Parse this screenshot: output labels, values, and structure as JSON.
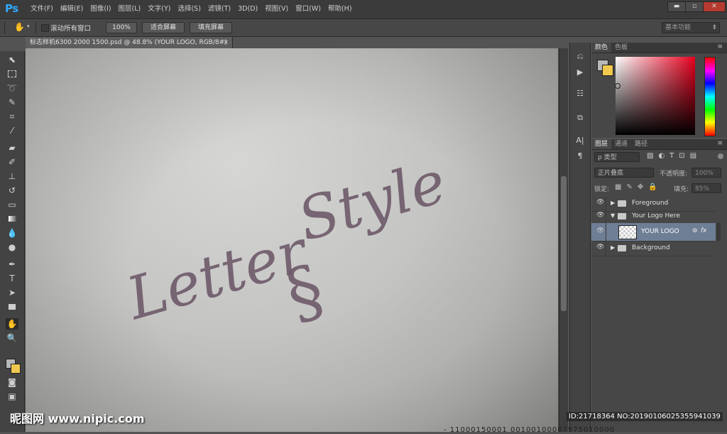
{
  "app": {
    "logo": "Ps"
  },
  "menu": [
    "文件(F)",
    "编辑(E)",
    "图像(I)",
    "图层(L)",
    "文字(Y)",
    "选择(S)",
    "滤镜(T)",
    "3D(D)",
    "视图(V)",
    "窗口(W)",
    "帮助(H)"
  ],
  "window_controls": {
    "minimize": "▬",
    "restore": "▫",
    "close": "✕"
  },
  "options": {
    "scroll_all_label": "滚动所有窗口",
    "btn_100": "100%",
    "btn_fit": "适合屏幕",
    "btn_fill": "填充屏幕",
    "workspace": "基本功能"
  },
  "document": {
    "tab_title": "标志样机6300 2000 1500.psd @ 48.8% (YOUR LOGO, RGB/8#)",
    "close": "×",
    "logo_word_1": "Letter",
    "logo_word_2": "Style",
    "logo_symbol": "§"
  },
  "color_panel": {
    "tabs": [
      "颜色",
      "色板"
    ],
    "fg_color": "#b8b8b8",
    "bg_color": "#f0c94e"
  },
  "layers_panel": {
    "tabs": [
      "图层",
      "通道",
      "路径"
    ],
    "filter_kind": "ρ 类型",
    "blend_mode": "正片叠底",
    "opacity_label": "不透明度:",
    "opacity_value": "100%",
    "lock_label": "锁定:",
    "fill_label": "填充:",
    "fill_value": "85%",
    "layers": [
      {
        "name": "Foreground",
        "type": "group",
        "expanded": false
      },
      {
        "name": "Your Logo Here",
        "type": "group",
        "expanded": true
      },
      {
        "name": "YOUR LOGO",
        "type": "smart-object",
        "selected": true,
        "fx": "fx"
      },
      {
        "name": "Background",
        "type": "group",
        "expanded": false
      }
    ]
  },
  "watermark": {
    "left": "昵图网 www.nipic.com",
    "right": "ID:21718364 NO:20190106025355941039",
    "bottom": "- 11000150001 00100100007975010000"
  }
}
